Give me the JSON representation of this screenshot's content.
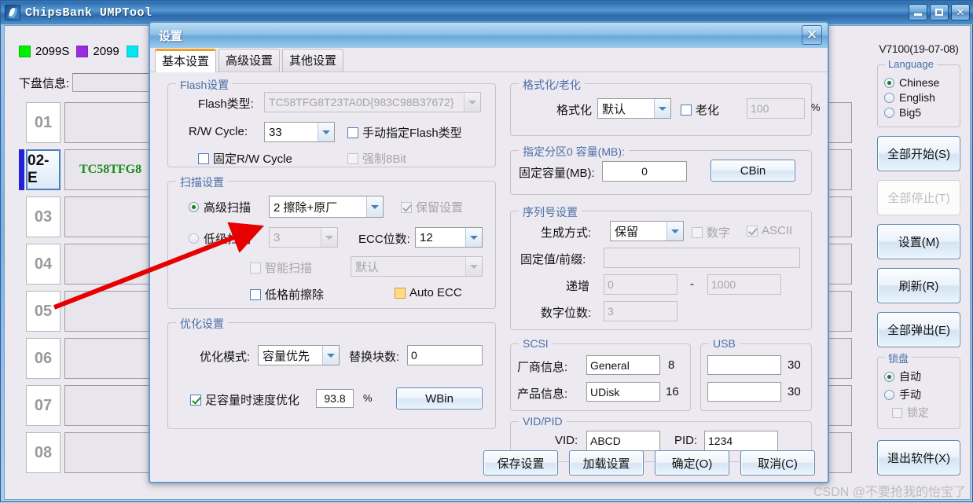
{
  "main_window": {
    "title": "ChipsBank UMPTool",
    "icon": "chip-icon",
    "window_controls": {
      "minimize": "minimize-icon",
      "maximize": "maximize-icon",
      "close": "close-icon"
    },
    "legend": [
      {
        "label": "2099S",
        "color": "#00ee00"
      },
      {
        "label": "2099",
        "color": "#9a2ce0"
      },
      {
        "label": "",
        "color": "#00e8f0"
      }
    ],
    "disk_info_label": "下盘信息:",
    "disk_info_value": "",
    "devices": [
      {
        "num": "01",
        "text": "",
        "active": false
      },
      {
        "num": "02-E",
        "text": "TC58TFG8",
        "active": true
      },
      {
        "num": "03",
        "text": "",
        "active": false
      },
      {
        "num": "04",
        "text": "",
        "active": false
      },
      {
        "num": "05",
        "text": "",
        "active": false
      },
      {
        "num": "06",
        "text": "",
        "active": false
      },
      {
        "num": "07",
        "text": "",
        "active": false
      },
      {
        "num": "08",
        "text": "",
        "active": false
      }
    ]
  },
  "right_panel": {
    "version": "V7100(19-07-08)",
    "language_group": {
      "title": "Language",
      "options": [
        {
          "label": "Chinese",
          "selected": true
        },
        {
          "label": "English",
          "selected": false
        },
        {
          "label": "Big5",
          "selected": false
        }
      ]
    },
    "buttons": [
      {
        "label": "全部开始(S)",
        "disabled": false
      },
      {
        "label": "全部停止(T)",
        "disabled": true
      },
      {
        "label": "设置(M)",
        "disabled": false
      },
      {
        "label": "刷新(R)",
        "disabled": false
      },
      {
        "label": "全部弹出(E)",
        "disabled": false
      }
    ],
    "lock_group": {
      "title": "锁盘",
      "options": [
        {
          "label": "自动",
          "selected": true
        },
        {
          "label": "手动",
          "selected": false
        }
      ],
      "lock_checkbox": {
        "label": "锁定",
        "checked": false,
        "disabled": true
      }
    },
    "exit_button": "退出软件(X)"
  },
  "dialog": {
    "title": "设置",
    "close_icon": "close-icon",
    "tabs": [
      {
        "label": "基本设置",
        "active": true
      },
      {
        "label": "高级设置",
        "active": false
      },
      {
        "label": "其他设置",
        "active": false
      }
    ],
    "flash_group": {
      "title": "Flash设置",
      "flash_type_label": "Flash类型:",
      "flash_type_value": "TC58TFG8T23TA0D{983C98B37672}",
      "rw_cycle_label": "R/W Cycle:",
      "rw_cycle_value": "33",
      "manual_flash_type": {
        "label": "手动指定Flash类型",
        "checked": false
      },
      "fixed_rw_cycle": {
        "label": "固定R/W Cycle",
        "checked": false
      },
      "force_8bit": {
        "label": "强制8Bit",
        "checked": false,
        "disabled": true
      }
    },
    "scan_group": {
      "title": "扫描设置",
      "advanced_scan": {
        "label": "高级扫描",
        "selected": true
      },
      "advanced_scan_value": "2 擦除+原厂",
      "keep_settings": {
        "label": "保留设置",
        "checked": true,
        "disabled": true
      },
      "low_scan": {
        "label": "低级扫描",
        "selected": false
      },
      "low_scan_value": "3",
      "ecc_bits_label": "ECC位数:",
      "ecc_bits_value": "12",
      "smart_scan": {
        "label": "智能扫描",
        "checked": false,
        "disabled": true
      },
      "smart_scan_value": "默认",
      "erase_before_lowfmt": {
        "label": "低格前擦除",
        "checked": false
      },
      "auto_ecc": {
        "label": "Auto ECC",
        "checked": false
      }
    },
    "optimize_group": {
      "title": "优化设置",
      "mode_label": "优化模式:",
      "mode_value": "容量优先",
      "replace_blocks_label": "替换块数:",
      "replace_blocks_value": "0",
      "speed_opt": {
        "label": "足容量时速度优化",
        "checked": true
      },
      "percent_value": "93.8",
      "percent_unit": "%",
      "wbin_button": "WBin"
    },
    "format_group": {
      "title": "格式化/老化",
      "format_label": "格式化",
      "format_value": "默认",
      "aging": {
        "label": "老化",
        "checked": false
      },
      "aging_value": "100",
      "aging_unit": "%"
    },
    "partition_group": {
      "title": "指定分区0 容量(MB):",
      "fixed_cap_label": "固定容量(MB):",
      "fixed_cap_value": "0",
      "cbin_button": "CBin"
    },
    "serial_group": {
      "title": "序列号设置",
      "gen_mode_label": "生成方式:",
      "gen_mode_value": "保留",
      "numeric": {
        "label": "数字",
        "checked": false,
        "disabled": true
      },
      "ascii": {
        "label": "ASCII",
        "checked": true,
        "disabled": true
      },
      "fixed_prefix_label": "固定值/前缀:",
      "fixed_prefix_value": "",
      "increment_label": "递增",
      "increment_from": "0",
      "increment_sep": "-",
      "increment_to": "1000",
      "digits_label": "数字位数:",
      "digits_value": "3"
    },
    "scsi_group": {
      "title": "SCSI",
      "vendor_label": "厂商信息:",
      "vendor_value": "General",
      "vendor_len": "8",
      "product_label": "产品信息:",
      "product_value": "UDisk",
      "product_len": "16"
    },
    "usb_group": {
      "title": "USB",
      "field1_value": "",
      "field1_len": "30",
      "field2_value": "",
      "field2_len": "30"
    },
    "vidpid_group": {
      "title": "VID/PID",
      "vid_label": "VID:",
      "vid_value": "ABCD",
      "pid_label": "PID:",
      "pid_value": "1234"
    },
    "buttons": [
      {
        "label": "保存设置"
      },
      {
        "label": "加载设置"
      },
      {
        "label": "确定(O)"
      },
      {
        "label": "取消(C)"
      }
    ]
  },
  "annotation": {
    "arrow": "red-arrow-pointing-to-advanced-scan-combo",
    "color": "#e60000"
  },
  "watermark": "CSDN @不要抢我的怡宝了"
}
